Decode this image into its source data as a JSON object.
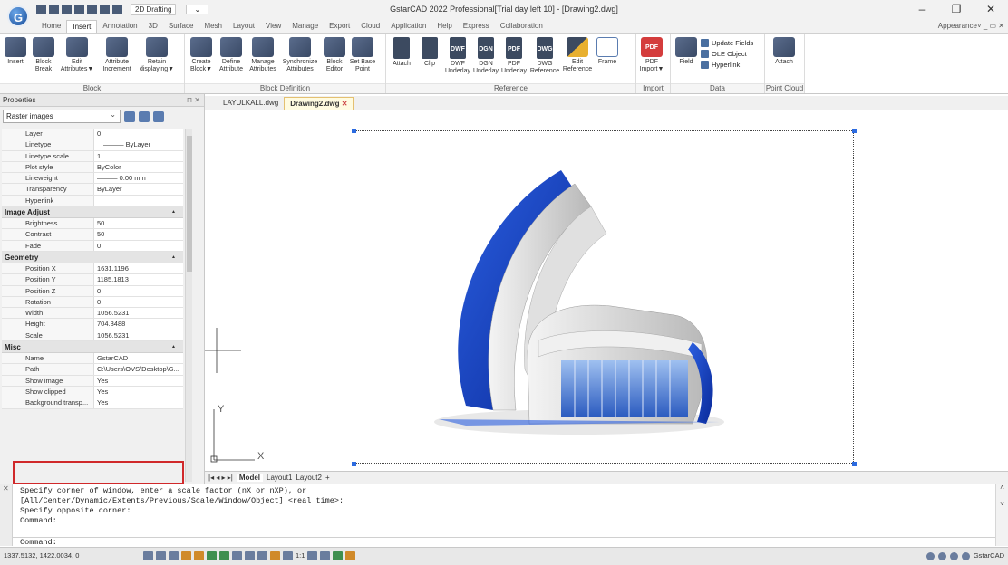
{
  "app": {
    "title": "GstarCAD 2022 Professional[Trial day left 10] - [Drawing2.dwg]",
    "logo_letter": "G",
    "workspace": "2D Drafting",
    "appearance": "Appearance"
  },
  "window_controls": {
    "minimize": "–",
    "restore": "❐",
    "close": "✕"
  },
  "ribbon_tabs": [
    "Home",
    "Insert",
    "Annotation",
    "3D",
    "Surface",
    "Mesh",
    "Layout",
    "View",
    "Manage",
    "Export",
    "Cloud",
    "Application",
    "Help",
    "Express",
    "Collaboration"
  ],
  "active_tab": "Insert",
  "ribbon": {
    "block": {
      "label": "Block",
      "buttons": [
        [
          "Insert",
          ""
        ],
        [
          "Block",
          "Break"
        ],
        [
          "Edit",
          "Attributes▼"
        ],
        [
          "Attribute",
          "Increment"
        ],
        [
          "Retain",
          "displaying▼"
        ]
      ]
    },
    "block_def": {
      "label": "Block Definition",
      "buttons": [
        [
          "Create",
          "Block▼"
        ],
        [
          "Define",
          "Attribute"
        ],
        [
          "Manage",
          "Attributes"
        ],
        [
          "Synchronize",
          "Attributes"
        ],
        [
          "Block",
          "Editor"
        ],
        [
          "Set Base",
          "Point"
        ]
      ]
    },
    "reference": {
      "label": "Reference",
      "buttons": [
        [
          "Attach",
          ""
        ],
        [
          "Clip",
          ""
        ],
        [
          "DWF",
          "Underlay"
        ],
        [
          "DGN",
          "Underlay"
        ],
        [
          "PDF",
          "Underlay"
        ],
        [
          "DWG",
          "Reference"
        ],
        [
          "Edit",
          "Reference"
        ],
        [
          "Frame",
          ""
        ]
      ],
      "icon_texts": [
        "DWF",
        "DGN",
        "PDF",
        "DWG"
      ]
    },
    "import": {
      "label": "Import",
      "buttons": [
        [
          "PDF",
          "Import▼"
        ]
      ],
      "icon_text": "PDF"
    },
    "data": {
      "label": "Data",
      "field": "Field",
      "update_fields": "Update Fields",
      "ole_object": "OLE Object",
      "hyperlink": "Hyperlink"
    },
    "point_cloud": {
      "label": "Point Cloud",
      "attach": "Attach"
    }
  },
  "properties": {
    "title": "Properties",
    "selector": "Raster images",
    "general": [
      {
        "k": "Layer",
        "v": "0"
      },
      {
        "k": "Linetype",
        "v": "——— ByLayer"
      },
      {
        "k": "Linetype scale",
        "v": "1"
      },
      {
        "k": "Plot style",
        "v": "ByColor"
      },
      {
        "k": "Lineweight",
        "v": "——— 0.00 mm"
      },
      {
        "k": "Transparency",
        "v": "ByLayer"
      },
      {
        "k": "Hyperlink",
        "v": ""
      }
    ],
    "image_adjust": {
      "title": "Image Adjust",
      "rows": [
        {
          "k": "Brightness",
          "v": "50"
        },
        {
          "k": "Contrast",
          "v": "50"
        },
        {
          "k": "Fade",
          "v": "0"
        }
      ]
    },
    "geometry": {
      "title": "Geometry",
      "rows": [
        {
          "k": "Position X",
          "v": "1631.1196"
        },
        {
          "k": "Position Y",
          "v": "1185.1813"
        },
        {
          "k": "Position Z",
          "v": "0"
        },
        {
          "k": "Rotation",
          "v": "0"
        },
        {
          "k": "Width",
          "v": "1056.5231"
        },
        {
          "k": "Height",
          "v": "704.3488"
        },
        {
          "k": "Scale",
          "v": "1056.5231"
        }
      ]
    },
    "misc": {
      "title": "Misc",
      "rows": [
        {
          "k": "Name",
          "v": "GstarCAD"
        },
        {
          "k": "Path",
          "v": "C:\\Users\\OVS\\Desktop\\G..."
        },
        {
          "k": "Show image",
          "v": "Yes"
        },
        {
          "k": "Show clipped",
          "v": "Yes"
        },
        {
          "k": "Background transp...",
          "v": "Yes"
        }
      ]
    }
  },
  "doc_tabs": [
    "LAYULKALL.dwg",
    "Drawing2.dwg"
  ],
  "layout_tabs": [
    "Model",
    "Layout1",
    "Layout2",
    "+"
  ],
  "command": {
    "lines": [
      "Specify corner of window, enter a scale factor (nX or nXP), or",
      "[All/Center/Dynamic/Extents/Previous/Scale/Window/Object] <real time>:",
      "Specify opposite corner:",
      "Command:"
    ],
    "input": "Command:"
  },
  "status": {
    "coords": "1337.5132, 1422.0034, 0",
    "scale": "1:1",
    "brand": "GstarCAD"
  },
  "axes": {
    "y": "Y",
    "x": "X"
  }
}
